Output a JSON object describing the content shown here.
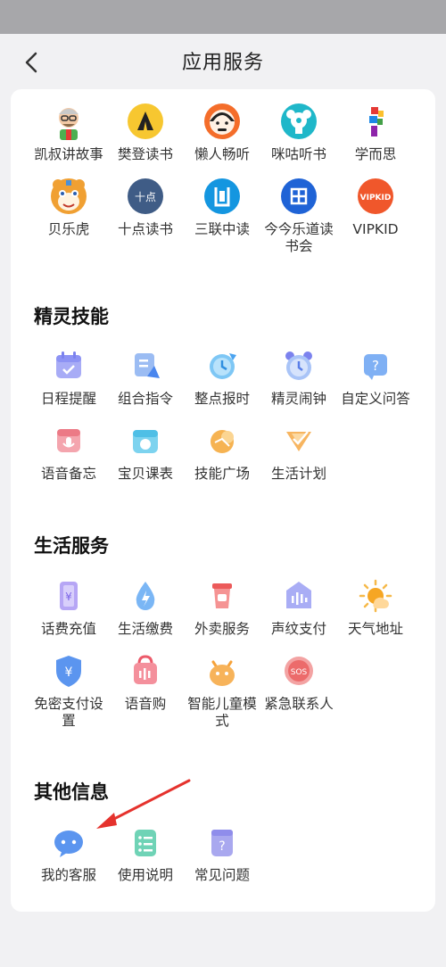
{
  "header": {
    "title": "应用服务"
  },
  "services_top": [
    "凯叔讲故事",
    "樊登读书",
    "懒人畅听",
    "咪咕听书",
    "学而思",
    "贝乐虎",
    "十点读书",
    "三联中读",
    "今今乐道读书会",
    "VIPKID"
  ],
  "sections": {
    "skills": {
      "title": "精灵技能",
      "items": [
        "日程提醒",
        "组合指令",
        "整点报时",
        "精灵闹钟",
        "自定义问答",
        "语音备忘",
        "宝贝课表",
        "技能广场",
        "生活计划"
      ]
    },
    "life": {
      "title": "生活服务",
      "items": [
        "话费充值",
        "生活缴费",
        "外卖服务",
        "声纹支付",
        "天气地址",
        "免密支付设置",
        "语音购",
        "智能儿童模式",
        "紧急联系人"
      ]
    },
    "other": {
      "title": "其他信息",
      "items": [
        "我的客服",
        "使用说明",
        "常见问题"
      ]
    }
  },
  "icon_text": {
    "sdds": "十点",
    "vipkid": "VIPKID",
    "sos": "SOS",
    "yen": "¥",
    "question": "?"
  },
  "colors": {
    "accent_purple": "#8d93f4",
    "accent_blue": "#4aa3f0",
    "arrow_red": "#e5322d"
  }
}
